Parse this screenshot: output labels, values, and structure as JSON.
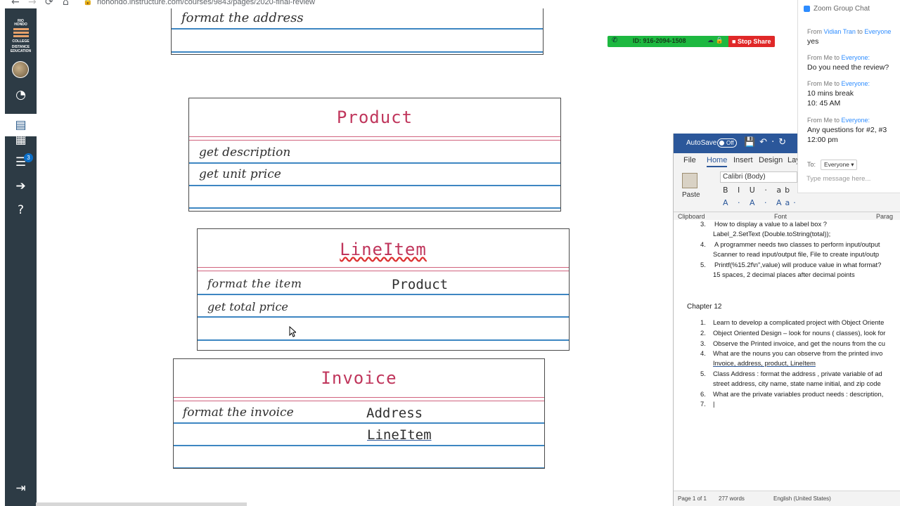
{
  "browser": {
    "url": "riohondo.instructure.com/courses/9843/pages/2020-final-review",
    "back": "←",
    "forward": "→",
    "reload": "⟳",
    "home": "⌂",
    "lock": "🔒"
  },
  "logo": {
    "line1": "RIO",
    "line2": "HONDO",
    "line3": "COLLEGE",
    "line4": "DISTANCE",
    "line5": "EDUCATION"
  },
  "leftnav": {
    "inbox_badge": "3"
  },
  "diagrams": {
    "top": {
      "row1": "format  the address"
    },
    "product": {
      "class": "Product",
      "m1": "get description",
      "m2": "get unit  price"
    },
    "lineitem": {
      "class": "LineItem",
      "m1": "format  the item",
      "m1_type": "Product",
      "m2": "get total  price"
    },
    "invoice": {
      "class": "Invoice",
      "m1": "format the invoice",
      "m1_type": "Address",
      "m2_type": "LineItem"
    }
  },
  "zoom_bar": {
    "meeting_id": "ID: 916-2094-1508",
    "stop_share": "Stop Share",
    "icons": "☁ 🔒"
  },
  "word": {
    "autosave": "AutoSave",
    "autosave_state": "Off",
    "tabs": [
      "File",
      "Home",
      "Insert",
      "Design",
      "Lay"
    ],
    "paste": "Paste",
    "font": "Calibri (Body)",
    "fmt_row1": "B I U · ab x₂ x²",
    "fmt_row2": "A · A · Aa·",
    "groups": {
      "clipboard": "Clipboard",
      "font": "Font",
      "paragraph": "Parag"
    },
    "doc": {
      "ch11": [
        {
          "num": "3.",
          "text": "How to display a value to a label box ?",
          "sub": "Label_2.SetText (Double.toString(total));"
        },
        {
          "num": "4.",
          "text": "A programmer needs two classes to perform input/output",
          "sub": "Scanner to read input/output file,  File to create input/outp"
        },
        {
          "num": "5.",
          "text": "Printf(%15.2f\\n\",value) will produce value in what format?",
          "sub": "15 spaces,  2 decimal places after decimal points"
        }
      ],
      "heading": "Chapter 12",
      "ch12": [
        {
          "num": "1.",
          "text": "Learn to develop a complicated project with Object Oriente"
        },
        {
          "num": "2.",
          "text": "Object Oriented Design – look for nouns ( classes), look for"
        },
        {
          "num": "3.",
          "text": "Observe the Printed invoice, and get the nouns from the cu"
        },
        {
          "num": "4.",
          "text": "What are the nouns you  can observe from the printed invo",
          "sub": "Invoice,  address,  product, LineItem"
        },
        {
          "num": "5.",
          "text": "Class Address :  format the address ,  private variable of ad",
          "sub": "street address, city name, state name initial, and zip code"
        },
        {
          "num": "6.",
          "text": "What are the private variables product needs : description,"
        },
        {
          "num": "7.",
          "text": ""
        }
      ]
    },
    "status": {
      "page": "Page 1 of 1",
      "words": "277 words",
      "lang": "English (United States)"
    }
  },
  "chat": {
    "title": "Zoom Group Chat",
    "messages": [
      {
        "from": "From ",
        "who": "Vidian Tran",
        "mid": " to ",
        "to": "Everyone",
        "lines": [
          "yes"
        ]
      },
      {
        "from": "From Me to ",
        "who": "",
        "mid": "",
        "to": "Everyone:",
        "lines": [
          "Do you need the review?"
        ]
      },
      {
        "from": "From Me to ",
        "who": "",
        "mid": "",
        "to": "Everyone:",
        "lines": [
          "10 mins break",
          "10: 45 AM"
        ]
      },
      {
        "from": "From Me to ",
        "who": "",
        "mid": "",
        "to": "Everyone:",
        "lines": [
          "Any questions for #2, #3",
          "12:00 pm"
        ]
      }
    ],
    "to_label": "To:",
    "to_value": "Everyone",
    "placeholder": "Type message here..."
  }
}
